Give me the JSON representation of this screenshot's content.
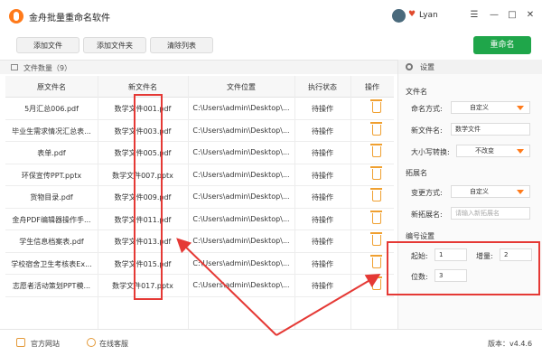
{
  "app": {
    "title": "金舟批量重命名软件",
    "username": "Lyan",
    "window_controls": [
      "☰",
      "—",
      "□",
      "✕"
    ]
  },
  "toolbar": {
    "add_file": "添加文件",
    "add_folder": "添加文件夹",
    "clear_list": "清除列表",
    "rename": "重命名"
  },
  "file_count": "文件数量（9）",
  "table": {
    "headers": [
      "原文件名",
      "新文件名",
      "文件位置",
      "执行状态",
      "操作"
    ],
    "rows": [
      [
        "5月汇总006.pdf",
        "数学文件001.pdf",
        "C:\\Users\\admin\\Desktop\\...",
        "待操作"
      ],
      [
        "毕业生需求情况汇总表...",
        "数学文件003.pdf",
        "C:\\Users\\admin\\Desktop\\...",
        "待操作"
      ],
      [
        "表单.pdf",
        "数学文件005.pdf",
        "C:\\Users\\admin\\Desktop\\...",
        "待操作"
      ],
      [
        "环保宣传PPT.pptx",
        "数学文件007.pptx",
        "C:\\Users\\admin\\Desktop\\...",
        "待操作"
      ],
      [
        "货物目录.pdf",
        "数学文件009.pdf",
        "C:\\Users\\admin\\Desktop\\...",
        "待操作"
      ],
      [
        "金舟PDF编辑器操作手...",
        "数学文件011.pdf",
        "C:\\Users\\admin\\Desktop\\...",
        "待操作"
      ],
      [
        "学生信息档案表.pdf",
        "数学文件013.pdf",
        "C:\\Users\\admin\\Desktop\\...",
        "待操作"
      ],
      [
        "学校宿舍卫生考核表Ex...",
        "数学文件015.pdf",
        "C:\\Users\\admin\\Desktop\\...",
        "待操作"
      ],
      [
        "志愿者活动策划PPT模...",
        "数学文件017.pptx",
        "C:\\Users\\admin\\Desktop\\...",
        "待操作"
      ]
    ]
  },
  "settings": {
    "title": "设置",
    "filename_section": "文件名",
    "naming_mode_label": "命名方式:",
    "naming_mode_value": "自定义",
    "new_filename_label": "新文件名:",
    "new_filename_value": "数学文件",
    "case_label": "大小写转换:",
    "case_value": "不改变",
    "ext_section": "拓展名",
    "change_mode_label": "变更方式:",
    "change_mode_value": "自定义",
    "new_ext_label": "新拓展名:",
    "new_ext_placeholder": "请输入新拓展名",
    "number_section": "编号设置",
    "start_label": "起始:",
    "start_value": "1",
    "increment_label": "增量:",
    "increment_value": "2",
    "digits_label": "位数:",
    "digits_value": "3"
  },
  "status": {
    "website": "官方网站",
    "support": "在线客服",
    "version": "版本：v4.4.6"
  },
  "colors": {
    "accent": "#ff7a1a",
    "primary_button": "#1fa64a",
    "annotation": "#e53935"
  }
}
